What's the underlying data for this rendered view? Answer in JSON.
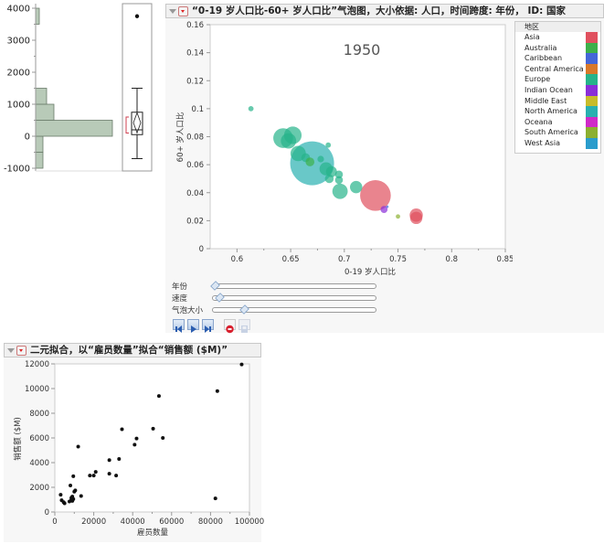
{
  "histogram": {
    "chart_data": {
      "type": "bar",
      "orientation": "horizontal",
      "bins": [
        {
          "low": -1000,
          "high": -500,
          "count": 2
        },
        {
          "low": -500,
          "high": 0,
          "count": 2
        },
        {
          "low": 0,
          "high": 500,
          "count": 21
        },
        {
          "low": 500,
          "high": 1000,
          "count": 5
        },
        {
          "low": 1000,
          "high": 1500,
          "count": 3
        },
        {
          "low": 3500,
          "high": 4000,
          "count": 1
        }
      ],
      "yticks": [
        "4000",
        "3000",
        "2000",
        "1000",
        "0",
        "-1000"
      ],
      "ylim": [
        -1100,
        4100
      ],
      "boxplot": {
        "min": -700,
        "q1": 50,
        "median": 200,
        "q3": 750,
        "max": 1500,
        "mean": 420,
        "outliers": [
          3750
        ]
      }
    },
    "bar_color": "#b8cab8"
  },
  "bubble": {
    "title": "“0-19 岁人口比-60+ 岁人口比”气泡图，大小依据: 人口，时间跨度: 年份， ID: 国家",
    "year_label": "1950",
    "legend": {
      "title": "地区",
      "items": [
        {
          "label": "Asia",
          "color": "#e0505e"
        },
        {
          "label": "Australia",
          "color": "#3db04a"
        },
        {
          "label": "Caribbean",
          "color": "#4466d8"
        },
        {
          "label": "Central America",
          "color": "#d8782a"
        },
        {
          "label": "Europe",
          "color": "#26b38a"
        },
        {
          "label": "Indian Ocean",
          "color": "#8a2ed8"
        },
        {
          "label": "Middle East",
          "color": "#c8bc2a"
        },
        {
          "label": "North America",
          "color": "#2ab0b0"
        },
        {
          "label": "Oceana",
          "color": "#d02ac8"
        },
        {
          "label": "South America",
          "color": "#8cb030"
        },
        {
          "label": "West Asia",
          "color": "#2a9ccc"
        }
      ]
    },
    "chart_data": {
      "type": "scatter",
      "xlabel": "0-19 岁人口比",
      "ylabel": "60+ 岁人口比",
      "xlim": [
        0.575,
        0.85
      ],
      "ylim": [
        0,
        0.16
      ],
      "xticks": [
        "0.6",
        "0.65",
        "0.7",
        "0.75",
        "0.8",
        "0.85"
      ],
      "yticks": [
        "0",
        "0.02",
        "0.04",
        "0.06",
        "0.08",
        "0.1",
        "0.12",
        "0.14",
        "0.16"
      ],
      "points": [
        {
          "x": 0.613,
          "y": 0.1,
          "size": 1.2,
          "region": "Europe"
        },
        {
          "x": 0.643,
          "y": 0.079,
          "size": 4.5,
          "region": "Europe"
        },
        {
          "x": 0.652,
          "y": 0.081,
          "size": 4.0,
          "region": "Europe"
        },
        {
          "x": 0.648,
          "y": 0.077,
          "size": 3.5,
          "region": "Europe"
        },
        {
          "x": 0.657,
          "y": 0.068,
          "size": 3.5,
          "region": "Europe"
        },
        {
          "x": 0.664,
          "y": 0.065,
          "size": 2.0,
          "region": "Europe"
        },
        {
          "x": 0.67,
          "y": 0.061,
          "size": 10.0,
          "region": "North America"
        },
        {
          "x": 0.668,
          "y": 0.062,
          "size": 2.0,
          "region": "Australia"
        },
        {
          "x": 0.678,
          "y": 0.064,
          "size": 1.5,
          "region": "Europe"
        },
        {
          "x": 0.685,
          "y": 0.074,
          "size": 1.2,
          "region": "Europe"
        },
        {
          "x": 0.683,
          "y": 0.057,
          "size": 3.0,
          "region": "Europe"
        },
        {
          "x": 0.688,
          "y": 0.055,
          "size": 2.5,
          "region": "Europe"
        },
        {
          "x": 0.686,
          "y": 0.05,
          "size": 2.0,
          "region": "Europe"
        },
        {
          "x": 0.695,
          "y": 0.053,
          "size": 1.8,
          "region": "Europe"
        },
        {
          "x": 0.695,
          "y": 0.049,
          "size": 1.8,
          "region": "Europe"
        },
        {
          "x": 0.696,
          "y": 0.041,
          "size": 3.5,
          "region": "Europe"
        },
        {
          "x": 0.711,
          "y": 0.044,
          "size": 2.8,
          "region": "Europe"
        },
        {
          "x": 0.729,
          "y": 0.038,
          "size": 7.0,
          "region": "Asia"
        },
        {
          "x": 0.737,
          "y": 0.028,
          "size": 1.6,
          "region": "Indian Ocean"
        },
        {
          "x": 0.74,
          "y": 0.03,
          "size": 0.6,
          "region": "Caribbean"
        },
        {
          "x": 0.75,
          "y": 0.023,
          "size": 1.0,
          "region": "South America"
        },
        {
          "x": 0.767,
          "y": 0.024,
          "size": 3.0,
          "region": "Asia"
        },
        {
          "x": 0.767,
          "y": 0.022,
          "size": 2.8,
          "region": "Asia"
        }
      ]
    },
    "controls": {
      "sliders": [
        {
          "label": "年份",
          "value": 0.0
        },
        {
          "label": "速度",
          "value": 0.03
        },
        {
          "label": "气泡大小",
          "value": 0.19
        }
      ],
      "buttons": [
        "step-back",
        "play",
        "step-forward",
        "record",
        "save"
      ]
    }
  },
  "bivariate": {
    "title": "二元拟合，以“雇员数量”拟合“销售额 ($M)”",
    "chart_data": {
      "type": "scatter",
      "xlabel": "雇员数量",
      "ylabel": "销售额 ($M)",
      "xlim": [
        0,
        100000
      ],
      "ylim": [
        0,
        12000
      ],
      "xticks": [
        "0",
        "20000",
        "40000",
        "60000",
        "80000",
        "100000"
      ],
      "yticks": [
        "0",
        "2000",
        "4000",
        "6000",
        "8000",
        "10000",
        "12000"
      ],
      "points": [
        [
          3000,
          1400
        ],
        [
          3500,
          950
        ],
        [
          4500,
          800
        ],
        [
          5000,
          700
        ],
        [
          7500,
          850
        ],
        [
          8000,
          2150
        ],
        [
          8500,
          1000
        ],
        [
          8500,
          1150
        ],
        [
          9000,
          1250
        ],
        [
          9000,
          900
        ],
        [
          9500,
          1050
        ],
        [
          9500,
          2900
        ],
        [
          10000,
          1650
        ],
        [
          10500,
          1750
        ],
        [
          12000,
          5300
        ],
        [
          13500,
          1300
        ],
        [
          18000,
          2950
        ],
        [
          20000,
          2950
        ],
        [
          21000,
          3250
        ],
        [
          28000,
          4200
        ],
        [
          28000,
          3100
        ],
        [
          31500,
          2950
        ],
        [
          33000,
          4300
        ],
        [
          34500,
          6700
        ],
        [
          41000,
          5450
        ],
        [
          42000,
          5950
        ],
        [
          50500,
          6750
        ],
        [
          53500,
          9400
        ],
        [
          55500,
          6000
        ],
        [
          82500,
          1100
        ],
        [
          83500,
          9800
        ],
        [
          96000,
          11950
        ]
      ]
    }
  }
}
